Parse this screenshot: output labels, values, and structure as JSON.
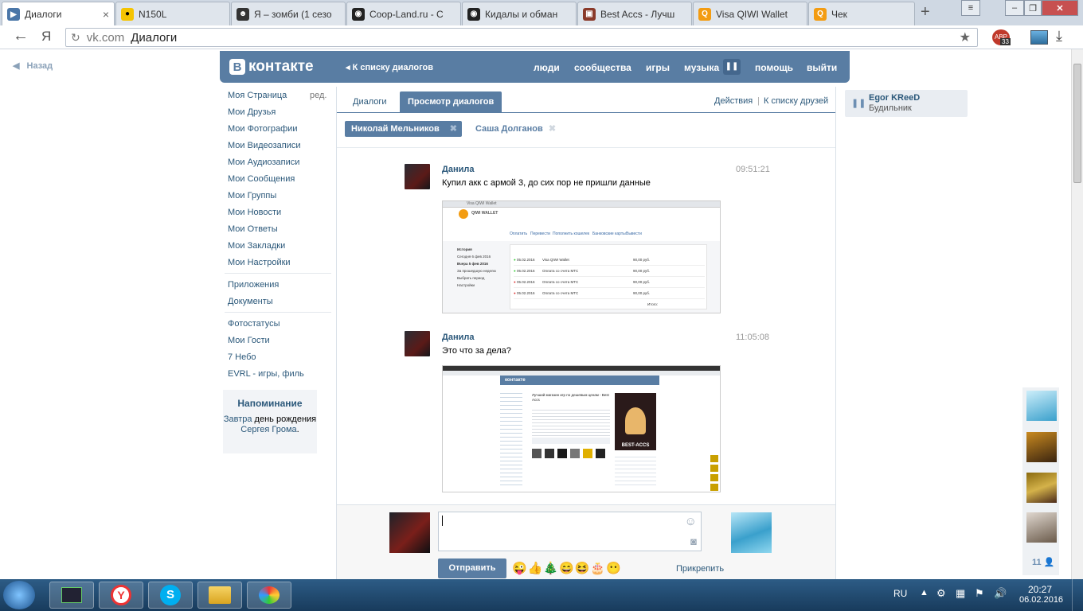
{
  "browser": {
    "tabs": [
      {
        "title": "Диалоги",
        "fav": "vk-icon",
        "color": "#4a76a8"
      },
      {
        "title": "N150L",
        "fav": "beeline-icon",
        "color": "#f5c400"
      },
      {
        "title": "Я – зомби (1 сезо",
        "fav": "zombie-icon",
        "color": "#333333"
      },
      {
        "title": "Coop-Land.ru - С",
        "fav": "coopland-icon",
        "color": "#222222"
      },
      {
        "title": "Кидалы и обман",
        "fav": "coopland-icon",
        "color": "#222222"
      },
      {
        "title": "Best Accs - Лучш",
        "fav": "bestaccs-icon",
        "color": "#8a3a2a"
      },
      {
        "title": "Visa QIWI Wallet",
        "fav": "qiwi-icon",
        "color": "#f39c12"
      },
      {
        "title": "Чек",
        "fav": "qiwi-icon",
        "color": "#f39c12"
      }
    ],
    "address": {
      "domain": "vk.com",
      "page": "Диалоги",
      "ya": "Я"
    },
    "badge": "33"
  },
  "vk": {
    "back": "Назад",
    "logo": "контакте",
    "logo_letter": "В",
    "to_list": "К списку диалогов",
    "nav": [
      "люди",
      "сообщества",
      "игры",
      "музыка",
      "помощь",
      "выйти"
    ],
    "menu": [
      {
        "label": "Моя Страница",
        "extra": "ред."
      },
      {
        "label": "Мои Друзья"
      },
      {
        "label": "Мои Фотографии"
      },
      {
        "label": "Мои Видеозаписи"
      },
      {
        "label": "Мои Аудиозаписи"
      },
      {
        "label": "Мои Сообщения"
      },
      {
        "label": "Мои Группы"
      },
      {
        "label": "Мои Новости"
      },
      {
        "label": "Мои Ответы"
      },
      {
        "label": "Мои Закладки"
      },
      {
        "label": "Мои Настройки"
      }
    ],
    "menu2": [
      "Приложения",
      "Документы"
    ],
    "menu3": [
      "Фотостатусы",
      "Мои Гости",
      "7 Небо",
      "EVRL - игры, филь"
    ],
    "reminder": {
      "title": "Напоминание",
      "t1": "Завтра",
      "t2": " день рождения ",
      "t3": "Сергея Грома",
      "t4": "."
    },
    "tabs": {
      "dialogs": "Диалоги",
      "view": "Просмотр диалогов",
      "actions": "Действия",
      "sep": "|",
      "friends": "К списку друзей"
    },
    "chips": [
      "Николай Мельников",
      "Саша Долганов"
    ],
    "messages": [
      {
        "name": "Данила",
        "time": "09:51:21",
        "text": "Купил акк с армой 3, до сих пор не пришли данные"
      },
      {
        "name": "Данила",
        "time": "11:05:08",
        "text": "Это что за дела?"
      }
    ],
    "send": "Отправить",
    "attach": "Прикрепить",
    "player": {
      "artist": "Egor KReeD",
      "song": "Будильник"
    },
    "friends_count": "11"
  },
  "shot1": {
    "addr": "Visa QIWI Wallet",
    "brand": "QIWI WALLET",
    "menu": [
      "Оплатить",
      "Перевести",
      "Пополнить кошелек",
      "Банковские карты",
      "Вывести"
    ],
    "side": [
      "История",
      "Сегодня 6 фев 2016",
      "Вчера 5 фев 2016",
      "За прошедшую неделю",
      "Выбрать период",
      "Настройки"
    ],
    "rows": [
      {
        "date": "05.02.2016",
        "desc": "Visa QIWI Wallet",
        "sum": "90,00 руб."
      },
      {
        "date": "05.02.2016",
        "desc": "Оплата со счета МТС",
        "sum": "90,00 руб."
      },
      {
        "date": "05.02.2016",
        "desc": "Оплата со счета МТС",
        "sum": "90,00 руб."
      },
      {
        "date": "05.02.2016",
        "desc": "Оплата со счета МТС",
        "sum": "90,00 руб."
      }
    ],
    "total": "Итого:"
  },
  "shot2": {
    "brand": "контакте",
    "group": "Лучший магазин игр по дешевым ценам - Best Accs",
    "poster": "BEST-ACCS"
  },
  "taskbar": {
    "lang": "RU",
    "time": "20:27",
    "date": "06.02.2016"
  }
}
